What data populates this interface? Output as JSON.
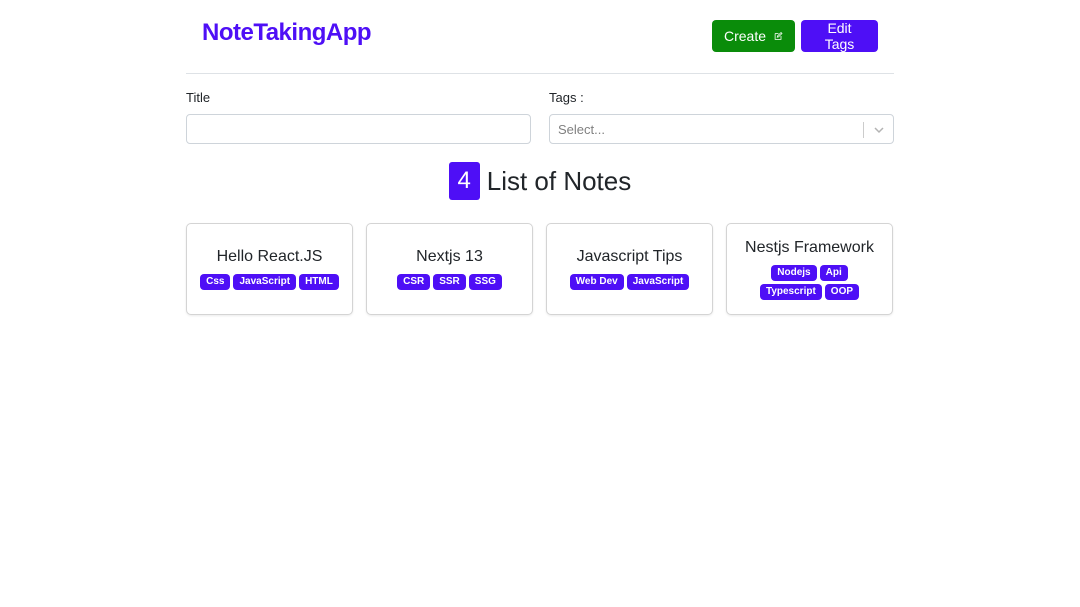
{
  "header": {
    "brand": "NoteTakingApp",
    "create_label": "Create",
    "edit_tags_label": "Edit Tags"
  },
  "form": {
    "title_label": "Title",
    "title_value": "",
    "tags_label": "Tags :",
    "tags_placeholder": "Select..."
  },
  "notes_heading": {
    "count": "4",
    "text": "List of Notes"
  },
  "notes": [
    {
      "title": "Hello React.JS",
      "tags": [
        "Css",
        "JavaScript",
        "HTML"
      ]
    },
    {
      "title": "Nextjs 13",
      "tags": [
        "CSR",
        "SSR",
        "SSG"
      ]
    },
    {
      "title": "Javascript Tips",
      "tags": [
        "Web Dev",
        "JavaScript"
      ]
    },
    {
      "title": "Nestjs Framework",
      "tags": [
        "Nodejs",
        "Api",
        "Typescript",
        "OOP"
      ]
    }
  ],
  "colors": {
    "accent": "#4e0ff6",
    "create_button": "#0a8c0a",
    "divider": "#dee2e6"
  },
  "icons": {
    "create": "edit-pencil-icon",
    "select_dropdown": "chevron-down-icon"
  }
}
